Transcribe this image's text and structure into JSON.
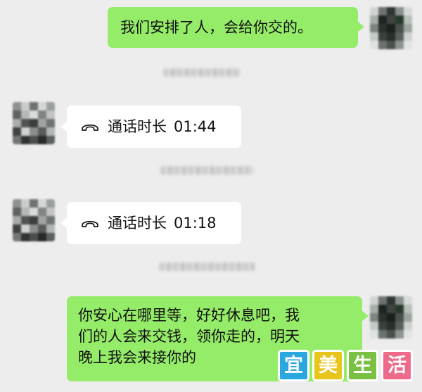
{
  "messages": {
    "outgoing_1": "我们安排了人，会给你交的。",
    "call_1": {
      "label": "通话时长",
      "duration": "01:44"
    },
    "call_2": {
      "label": "通话时长",
      "duration": "01:18"
    },
    "outgoing_2": {
      "lines": [
        "你安心在哪里等，好好休息吧，我",
        "们的人会来交钱，领你走的，明天",
        "晚上我会来接你的"
      ]
    }
  },
  "watermark": {
    "chars": [
      "宜",
      "美",
      "生",
      "活"
    ],
    "colors": [
      "#2aa7df",
      "#e8c51b",
      "#79c043",
      "#ee6a8a"
    ]
  },
  "icons": {
    "call": "phone-handset-icon"
  },
  "colors": {
    "background": "#ededed",
    "outgoing_bubble": "#95ec69",
    "incoming_bubble": "#ffffff"
  }
}
